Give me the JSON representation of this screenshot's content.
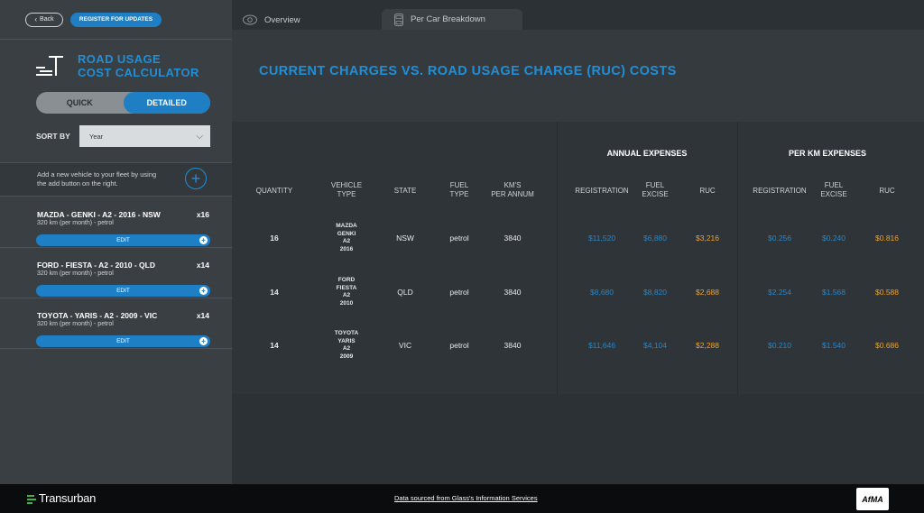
{
  "sidebar": {
    "back_label": "Back",
    "register_label": "REGISTER FOR UPDATES",
    "brand_line1": "ROAD USAGE",
    "brand_line2": "COST CALCULATOR",
    "toggle_quick": "QUICK",
    "toggle_detailed": "DETAILED",
    "toggle_active": "DETAILED",
    "sort_label": "SORT BY",
    "sort_value": "Year",
    "add_text": "Add a new vehicle to your fleet by using the add button on the right.",
    "edit_label": "EDIT",
    "vehicles": [
      {
        "name": "MAZDA - GENKI - A2 - 2016 - NSW",
        "qty": "x16",
        "sub": "320 km (per month) - petrol"
      },
      {
        "name": "FORD - FIESTA - A2 - 2010 - QLD",
        "qty": "x14",
        "sub": "320 km (per month) - petrol"
      },
      {
        "name": "TOYOTA - YARIS - A2 - 2009 - VIC",
        "qty": "x14",
        "sub": "320 km (per month) - petrol"
      }
    ]
  },
  "tabs": {
    "overview": "Overview",
    "breakdown": "Per Car Breakdown",
    "active": "Per Car Breakdown"
  },
  "main": {
    "title": "CURRENT CHARGES VS. ROAD USAGE CHARGE (RUC) COSTS"
  },
  "table": {
    "group_annual": "ANNUAL EXPENSES",
    "group_perkm": "PER KM EXPENSES",
    "headers": {
      "quantity": "QUANTITY",
      "vehicle_type_1": "VEHICLE",
      "vehicle_type_2": "TYPE",
      "state": "STATE",
      "fuel_type_1": "FUEL",
      "fuel_type_2": "TYPE",
      "km_1": "KM'S",
      "km_2": "PER ANNUM",
      "registration": "REGISTRATION",
      "fuel_excise_1": "FUEL",
      "fuel_excise_2": "EXCISE",
      "ruc": "RUC",
      "pk_registration": "REGISTRATION",
      "pk_fuel_excise_1": "FUEL",
      "pk_fuel_excise_2": "EXCISE",
      "pk_ruc": "RUC"
    },
    "rows": [
      {
        "quantity": "16",
        "vt1": "MAZDA",
        "vt2": "GENKI",
        "vt3": "A2",
        "vt4": "2016",
        "state": "NSW",
        "fuel": "petrol",
        "km": "3840",
        "registration": "$11,520",
        "fuel_excise": "$6,880",
        "ruc": "$3,216",
        "pk_registration": "$0.256",
        "pk_fuel_excise": "$0.240",
        "pk_ruc": "$0.816"
      },
      {
        "quantity": "14",
        "vt1": "FORD",
        "vt2": "FIESTA",
        "vt3": "A2",
        "vt4": "2010",
        "state": "QLD",
        "fuel": "petrol",
        "km": "3840",
        "registration": "$8,680",
        "fuel_excise": "$8,820",
        "ruc": "$2,688",
        "pk_registration": "$2.254",
        "pk_fuel_excise": "$1.568",
        "pk_ruc": "$0.588"
      },
      {
        "quantity": "14",
        "vt1": "TOYOTA",
        "vt2": "YARIS",
        "vt3": "A2",
        "vt4": "2009",
        "state": "VIC",
        "fuel": "petrol",
        "km": "3840",
        "registration": "$11,646",
        "fuel_excise": "$4,104",
        "ruc": "$2,288",
        "pk_registration": "$0.210",
        "pk_fuel_excise": "$1.540",
        "pk_ruc": "$0.686"
      }
    ]
  },
  "footer": {
    "logo_text": "Transurban",
    "source_text": "Data sourced from Glass's Information Services",
    "badge_text": "AfMA"
  },
  "colors": {
    "accent_blue": "#1f8fd8",
    "ruc_orange": "#f0a02c",
    "value_blue": "#2a86c6"
  }
}
